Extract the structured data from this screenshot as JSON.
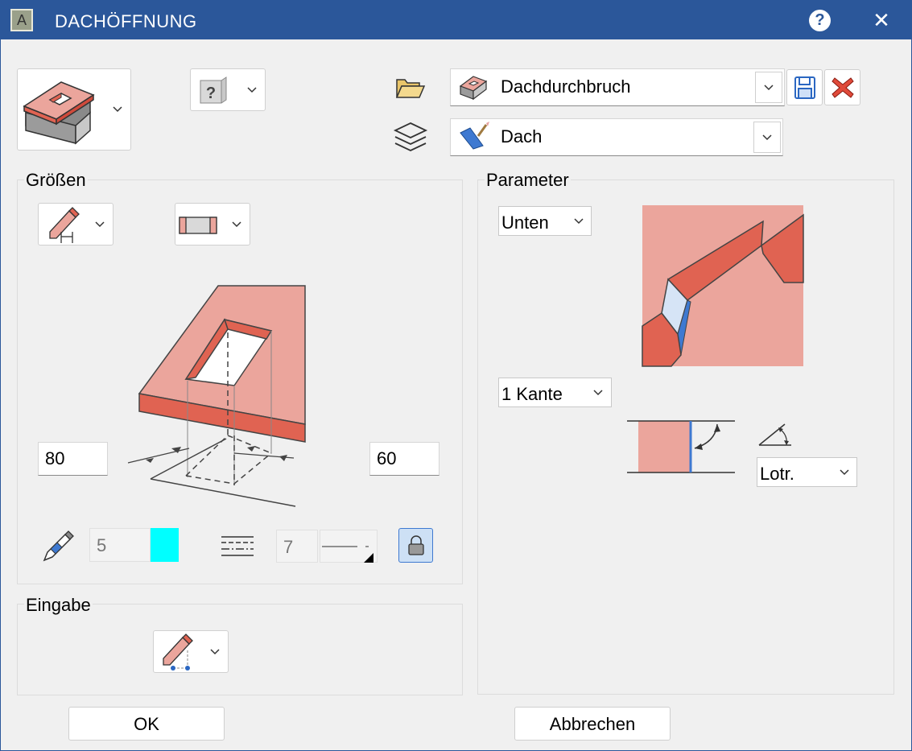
{
  "titlebar": {
    "title": "DACHÖFFNUNG",
    "app_icon_letter": "A",
    "help_label": "?",
    "close_label": "✕"
  },
  "favorites": {
    "name": "Dachdurchbruch"
  },
  "layer": {
    "name": "Dach"
  },
  "groups": {
    "sizes": "Größen",
    "parameter": "Parameter",
    "input": "Eingabe"
  },
  "sizes": {
    "width": "80",
    "depth": "60"
  },
  "pen": {
    "number": "5",
    "color": "#00ffff"
  },
  "line": {
    "number": "7"
  },
  "parameter": {
    "position": "Unten",
    "edges": "1 Kante",
    "angle_mode": "Lotr."
  },
  "buttons": {
    "ok": "OK",
    "cancel": "Abbrechen"
  },
  "colors": {
    "titlebar": "#2b579a",
    "roof_light": "#eba59c",
    "roof_dark": "#e06352"
  }
}
